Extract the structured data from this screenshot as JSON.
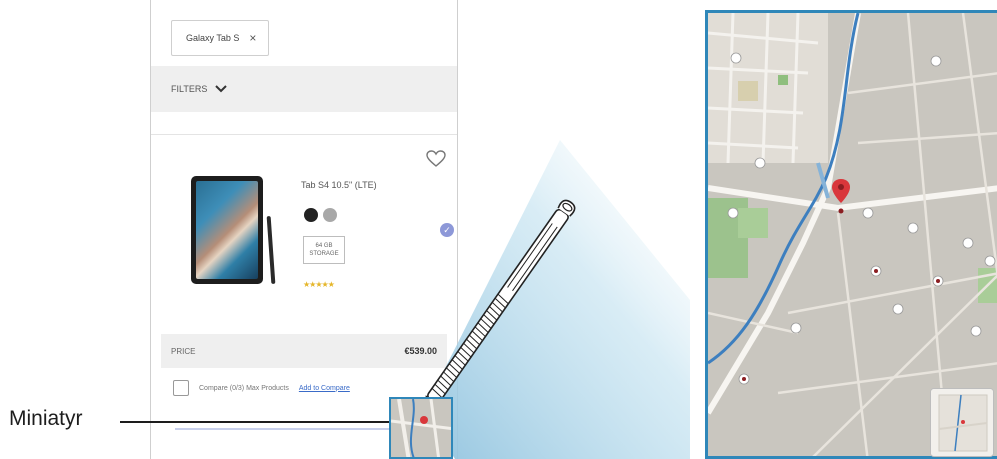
{
  "search_chip": {
    "label": "Galaxy Tab S",
    "close": "×"
  },
  "filter": {
    "label": "FILTERS"
  },
  "product": {
    "title": "Tab S4 10.5\" (LTE)",
    "size_option": "64 GB STORAGE",
    "rating": "★★★★★"
  },
  "price": {
    "label": "PRICE",
    "value": "€539.00"
  },
  "compare": {
    "text": "Compare (0/3) Max Products",
    "link": "Add to Compare"
  },
  "callout": {
    "label": "Miniatyr"
  },
  "colors": {
    "accent": "#2f87b9",
    "map_base": "#c9c6bf",
    "pin": "#d9373b"
  }
}
